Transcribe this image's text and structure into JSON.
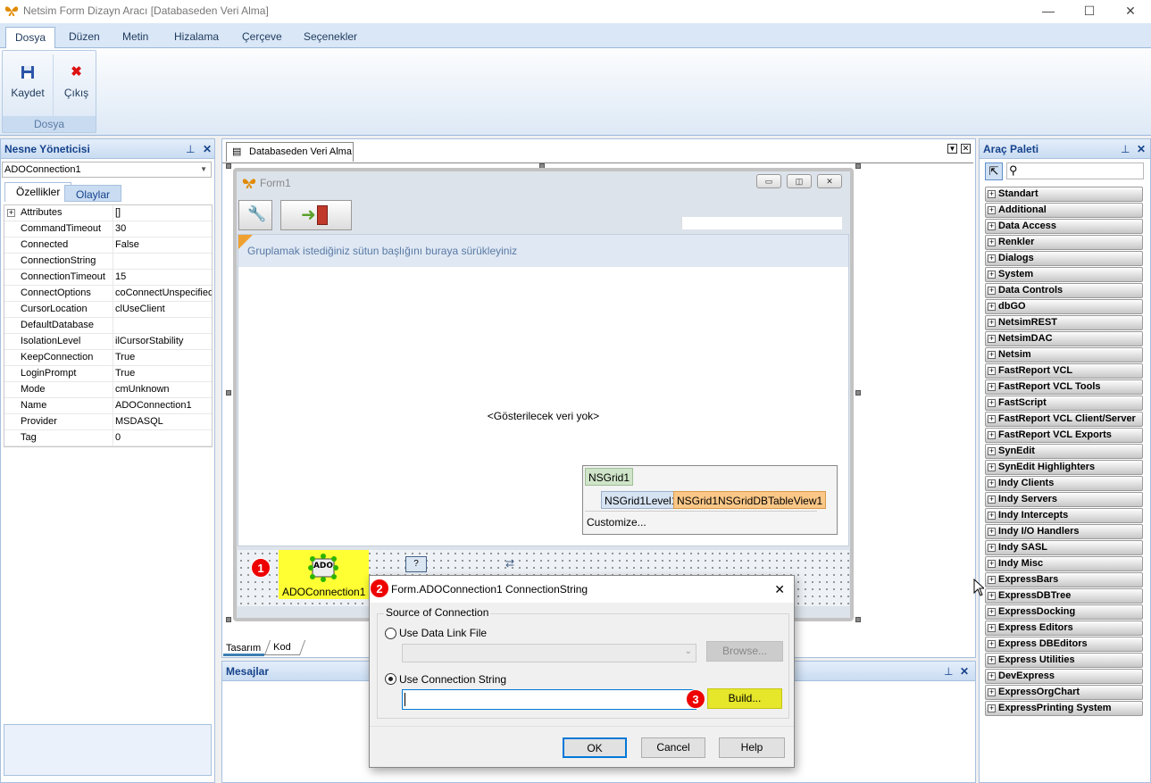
{
  "window": {
    "title": "Netsim Form Dizayn Aracı [Databaseden Veri Alma]",
    "minimize": "—",
    "maximize": "☐",
    "close": "✕"
  },
  "ribbon": {
    "tabs": [
      "Dosya",
      "Düzen",
      "Metin",
      "Hizalama",
      "Çerçeve",
      "Seçenekler"
    ],
    "group_label": "Dosya",
    "save_label": "Kaydet",
    "exit_label": "Çıkış"
  },
  "object_manager": {
    "title": "Nesne Yöneticisi",
    "selected_object": "ADOConnection1",
    "tabs": [
      "Özellikler",
      "Olaylar"
    ],
    "properties": [
      {
        "name": "Attributes",
        "value": "[]",
        "expandable": true
      },
      {
        "name": "CommandTimeout",
        "value": "30"
      },
      {
        "name": "Connected",
        "value": "False"
      },
      {
        "name": "ConnectionString",
        "value": ""
      },
      {
        "name": "ConnectionTimeout",
        "value": "15"
      },
      {
        "name": "ConnectOptions",
        "value": "coConnectUnspecified"
      },
      {
        "name": "CursorLocation",
        "value": "clUseClient"
      },
      {
        "name": "DefaultDatabase",
        "value": ""
      },
      {
        "name": "IsolationLevel",
        "value": "ilCursorStability"
      },
      {
        "name": "KeepConnection",
        "value": "True"
      },
      {
        "name": "LoginPrompt",
        "value": "True"
      },
      {
        "name": "Mode",
        "value": "cmUnknown"
      },
      {
        "name": "Name",
        "value": "ADOConnection1"
      },
      {
        "name": "Provider",
        "value": "MSDASQL"
      },
      {
        "name": "Tag",
        "value": "0"
      }
    ]
  },
  "designer": {
    "doc_tab": "Databaseden Veri Alma",
    "form_title": "Form1",
    "group_hint": "Gruplamak istediğiniz sütun başlığını buraya sürükleyiniz",
    "no_data": "<Gösterilecek veri yok>",
    "nsgrid": {
      "title": "NSGrid1",
      "level": "NSGrid1Level1",
      "view": "NSGrid1NSGridDBTableView1",
      "customize": "Customize..."
    },
    "ado_component": "ADOConnection1",
    "ado_icon_text": "ADO",
    "bottom_tabs": [
      "Tasarım",
      "Kod"
    ]
  },
  "messages": {
    "title": "Mesajlar"
  },
  "palette": {
    "title": "Araç Paleti",
    "categories": [
      "Standart",
      "Additional",
      "Data Access",
      "Renkler",
      "Dialogs",
      "System",
      "Data Controls",
      "dbGO",
      "NetsimREST",
      "NetsimDAC",
      "Netsim",
      "FastReport VCL",
      "FastReport VCL Tools",
      "FastScript",
      "FastReport VCL Client/Server",
      "FastReport VCL Exports",
      "SynEdit",
      "SynEdit Highlighters",
      "Indy Clients",
      "Indy Servers",
      "Indy Intercepts",
      "Indy I/O Handlers",
      "Indy SASL",
      "Indy Misc",
      "ExpressBars",
      "ExpressDBTree",
      "ExpressDocking",
      "Express Editors",
      "Express DBEditors",
      "Express Utilities",
      "DevExpress",
      "ExpressOrgChart",
      "ExpressPrinting System"
    ]
  },
  "dialog": {
    "title": "Form.ADOConnection1 ConnectionString",
    "group_label": "Source of Connection",
    "opt_datalink": "Use Data Link File",
    "browse": "Browse...",
    "opt_connstring": "Use Connection String",
    "build": "Build...",
    "ok": "OK",
    "cancel": "Cancel",
    "help": "Help",
    "close": "✕"
  },
  "badges": [
    "1",
    "2",
    "3"
  ],
  "colors": {
    "highlight": "#ffff33",
    "badge": "#e00000",
    "accent": "#15428b"
  }
}
